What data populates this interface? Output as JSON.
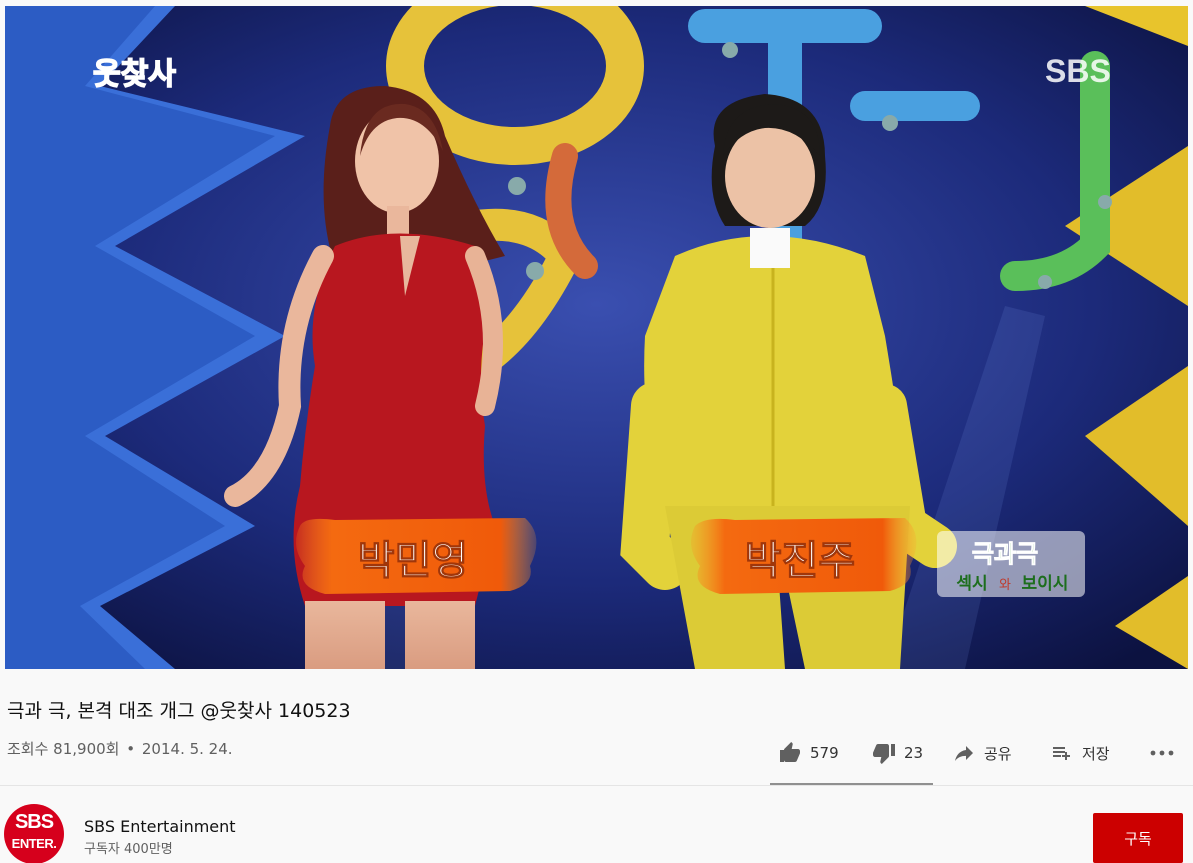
{
  "video": {
    "show_logo": "웃찾사",
    "broadcaster": "SBS",
    "caption_left": "박민영",
    "caption_right": "박진주",
    "corner_badge": {
      "top": "극과극",
      "bottom_a": "섹시",
      "bottom_mid": "와",
      "bottom_b": "보이시"
    }
  },
  "title": "극과 극, 본격 대조 개그 @웃찾사 140523",
  "meta": {
    "views": "조회수 81,900회",
    "separator": "•",
    "date": "2014. 5. 24."
  },
  "actions": {
    "like_count": "579",
    "dislike_count": "23",
    "share_label": "공유",
    "save_label": "저장",
    "like_ratio": 0.96
  },
  "channel": {
    "avatar_line1": "SBS",
    "avatar_line2": "ENTER.",
    "name": "SBS Entertainment",
    "subscribers": "구독자 400만명"
  },
  "subscribe_label": "구독",
  "colors": {
    "subscribe": "#cc0000",
    "avatar": "#d6001c",
    "stage_bg": "#1c2a7a"
  }
}
